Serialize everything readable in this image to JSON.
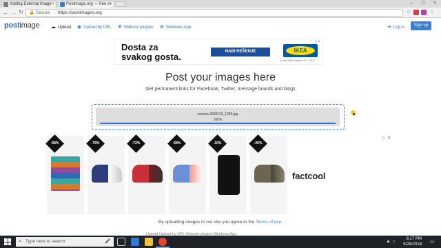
{
  "browser": {
    "tabs": [
      {
        "title": "Adding External Image",
        "active": false
      },
      {
        "title": "Postimage.org — free in",
        "active": true
      }
    ],
    "address": {
      "secure_label": "Secure",
      "url": "https://postimages.org"
    }
  },
  "site": {
    "logo_brand": "post",
    "logo_suffix": "image",
    "nav": {
      "upload": "Upload",
      "upload_by_url": "Upload by URL",
      "website_plugins": "Website plugins",
      "windows_app": "Windows App",
      "login": "Log in",
      "signup": "Sign up"
    }
  },
  "ad_ikea": {
    "headline_line1": "Dosta za",
    "headline_line2": "svakog gosta.",
    "button_label": "NAĐI REŠENJE",
    "logo_text": "IKEA",
    "copyright": "© Inter IKEA Systems B.V. 2018"
  },
  "main": {
    "title": "Post your images here",
    "subtitle": "Get permanent links for Facebook, Twitter, message boards and blogs"
  },
  "upload": {
    "filename": "woman-3088116_1280.jpg",
    "percent_label": "100%",
    "progress": 1.0
  },
  "ad_factcool": {
    "brand": "factcool",
    "products": [
      {
        "badge": "-58%",
        "name": "briefs-pack"
      },
      {
        "badge": "-79%",
        "name": "canvas-sneakers"
      },
      {
        "badge": "-72%",
        "name": "red-sandals"
      },
      {
        "badge": "-58%",
        "name": "running-shoes"
      },
      {
        "badge": "-10%",
        "name": "tracksuit"
      },
      {
        "badge": "-26%",
        "name": "hiking-shoes"
      }
    ]
  },
  "terms": {
    "prefix": "By uploading images to our site you agree to the",
    "link": "Terms of use",
    "suffix": "."
  },
  "ghost_row": "Upload     Upload by URL     Website plugins     Windows App",
  "taskbar": {
    "search_placeholder": "Type here to search",
    "time": "6:17 PM",
    "date": "5/29/2018"
  }
}
